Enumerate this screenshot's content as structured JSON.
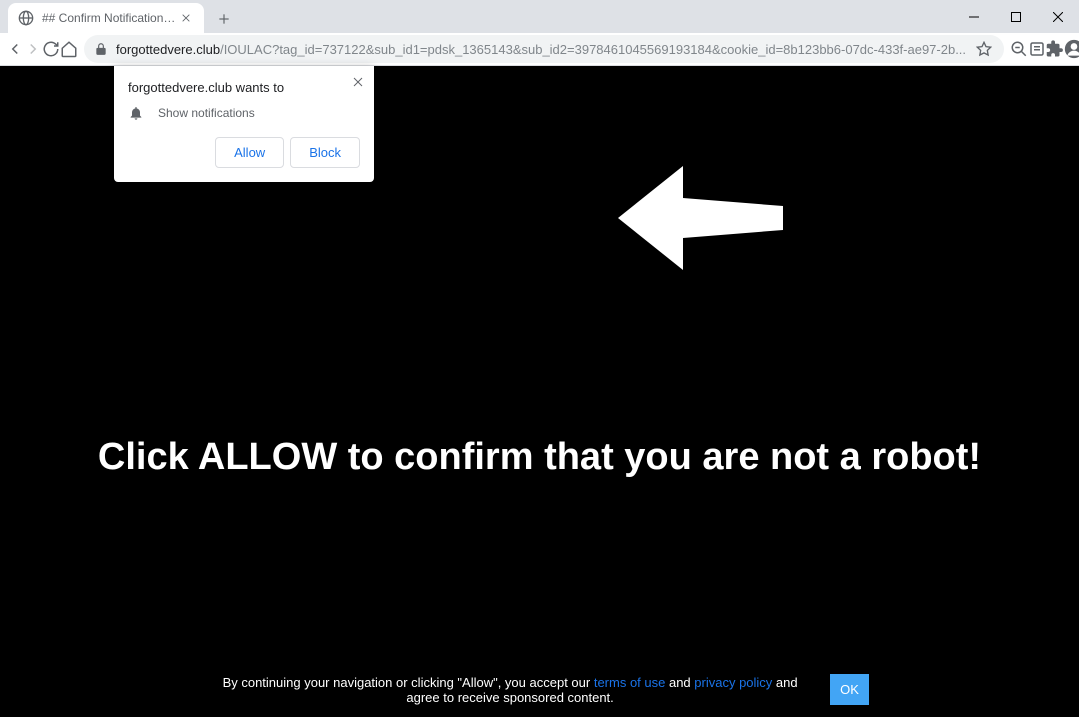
{
  "window": {
    "tab_title": "## Confirm Notifications ##"
  },
  "address": {
    "domain": "forgottedvere.club",
    "path": "/IOULAC?tag_id=737122&sub_id1=pdsk_1365143&sub_id2=3978461045569193184&cookie_id=8b123bb6-07dc-433f-ae97-2b..."
  },
  "permission": {
    "title": "forgottedvere.club wants to",
    "message": "Show notifications",
    "allow_label": "Allow",
    "block_label": "Block"
  },
  "page": {
    "headline": "Click ALLOW to confirm that you are not a robot!",
    "footer_pre": "By continuing your navigation or clicking \"Allow\", you accept our ",
    "terms_label": "terms of use",
    "footer_and": " and ",
    "privacy_label": "privacy policy",
    "footer_post": " and agree to receive sponsored content.",
    "ok_label": "OK"
  }
}
